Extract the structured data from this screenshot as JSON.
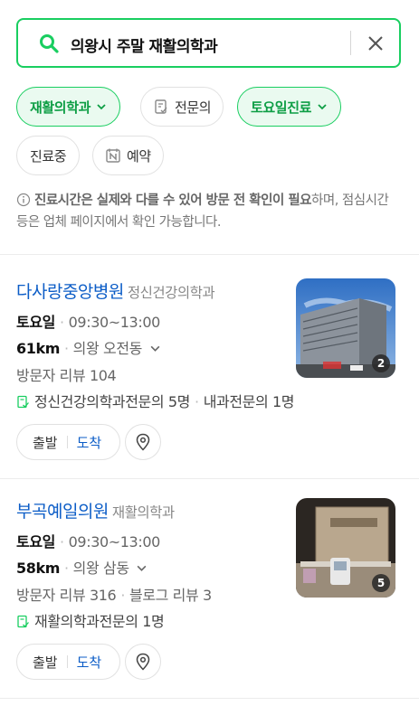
{
  "search": {
    "query": "의왕시 주말 재활의학과"
  },
  "filters": [
    {
      "label": "재활의학과",
      "active": true
    },
    {
      "label": "전문의",
      "active": false
    },
    {
      "label": "토요일진료",
      "active": true
    },
    {
      "label": "진료중",
      "active": false
    },
    {
      "label": "예약",
      "active": false
    }
  ],
  "notice": {
    "bold_part": "진료시간은 실제와 다를 수 있어 방문 전 확인이 필요",
    "rest": "하며, 점심시간 등은 업체 페이지에서 확인 가능합니다."
  },
  "places": [
    {
      "name": "다사랑중앙병원",
      "category": "정신건강의학과",
      "day": "토요일",
      "hours": "09:30~13:00",
      "distance": "61km",
      "address": "의왕 오전동",
      "reviews": [
        "방문자 리뷰 104"
      ],
      "specialists": [
        "정신건강의학과전문의 5명",
        "내과전문의 1명"
      ],
      "photo_count": "2",
      "depart_label": "출발",
      "arrive_label": "도착"
    },
    {
      "name": "부곡예일의원",
      "category": "재활의학과",
      "day": "토요일",
      "hours": "09:30~13:00",
      "distance": "58km",
      "address": "의왕 삼동",
      "reviews": [
        "방문자 리뷰 316",
        "블로그 리뷰 3"
      ],
      "specialists": [
        "재활의학과전문의 1명"
      ],
      "photo_count": "5",
      "depart_label": "출발",
      "arrive_label": "도착"
    }
  ],
  "colors": {
    "accent": "#19ce60",
    "link": "#0c5dc7"
  },
  "icons": [
    "search-icon",
    "close-icon",
    "chevron-down-icon",
    "specialist-icon",
    "reservation-icon",
    "info-icon",
    "map-pin-icon"
  ]
}
